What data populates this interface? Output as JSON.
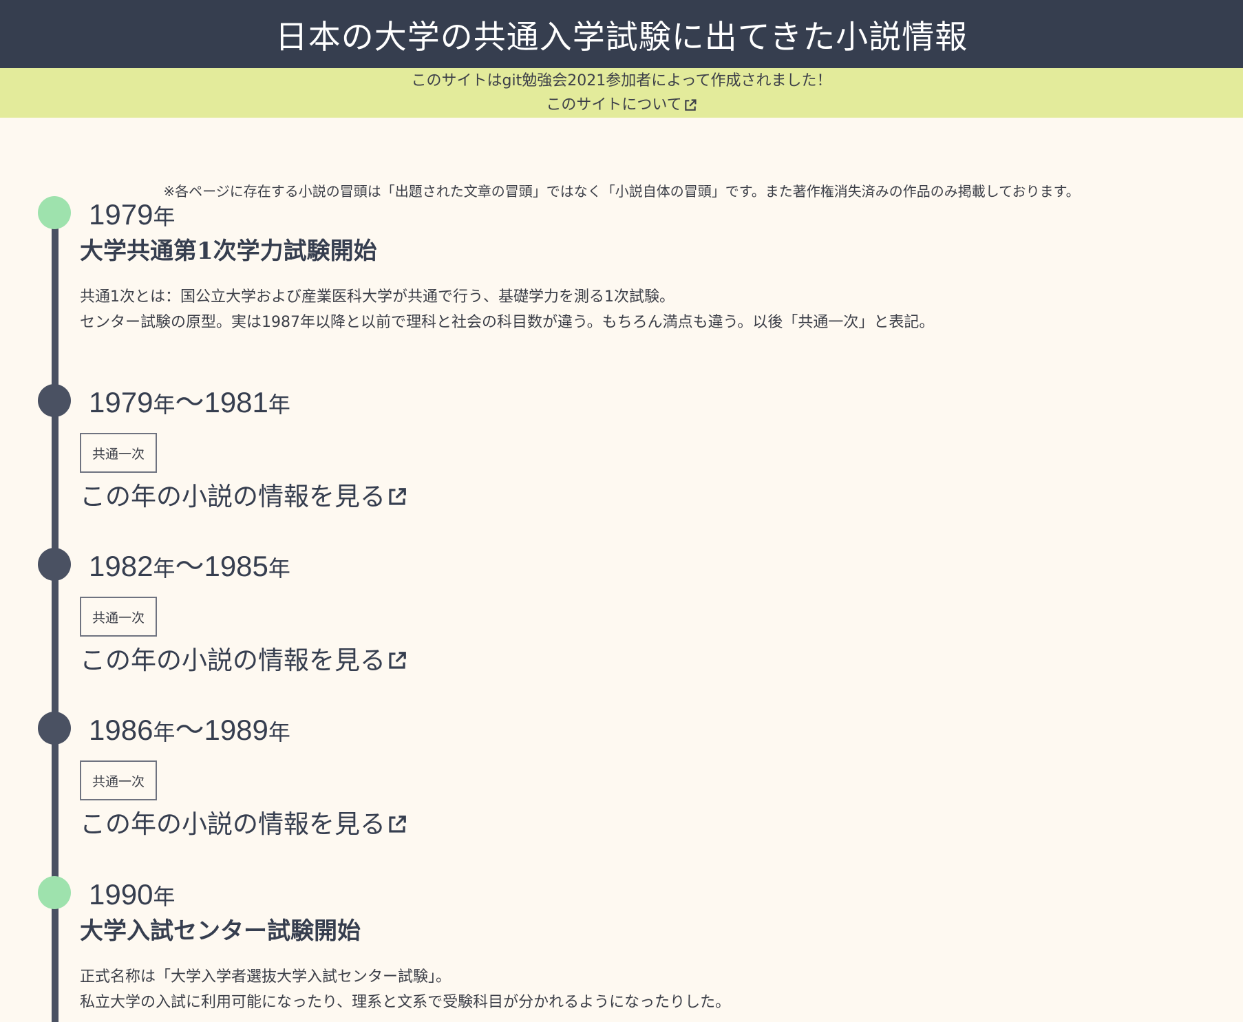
{
  "header": {
    "title": "日本の大学の共通入学試験に出てきた小説情報"
  },
  "banner": {
    "line1": "このサイトはgit勉強会2021参加者によって作成されました！",
    "about_link": "このサイトについて"
  },
  "notice": "※各ページに存在する小説の冒頭は「出題された文章の冒頭」ではなく「小説自体の冒頭」です。また著作権消失済みの作品のみ掲載しております。",
  "timeline": [
    {
      "type": "event",
      "year": "1979",
      "year_suffix": "年",
      "title": "大学共通第1次学力試験開始",
      "desc_line1": "共通1次とは：国公立大学および産業医科大学が共通で行う、基礎学力を測る1次試験。",
      "desc_line2": "センター試験の原型。実は1987年以降と以前で理科と社会の科目数が違う。もちろん満点も違う。以後「共通一次」と表記。"
    },
    {
      "type": "period",
      "start": "1979",
      "end": "1981",
      "year_suffix": "年",
      "separator": "～",
      "tag": "共通一次",
      "link": "この年の小説の情報を見る"
    },
    {
      "type": "period",
      "start": "1982",
      "end": "1985",
      "year_suffix": "年",
      "separator": "～",
      "tag": "共通一次",
      "link": "この年の小説の情報を見る"
    },
    {
      "type": "period",
      "start": "1986",
      "end": "1989",
      "year_suffix": "年",
      "separator": "～",
      "tag": "共通一次",
      "link": "この年の小説の情報を見る"
    },
    {
      "type": "event",
      "year": "1990",
      "year_suffix": "年",
      "title": "大学入試センター試験開始",
      "desc_line1": "正式名称は「大学入学者選抜大学入試センター試験」。",
      "desc_line2": "私立大学の入試に利用可能になったり、理系と文系で受験科目が分かれるようになったりした。"
    }
  ],
  "colors": {
    "header_bg": "#363e4f",
    "banner_bg": "#e3eb9b",
    "page_bg": "#fef9f1",
    "event_marker": "#9ee2ad",
    "period_marker": "#4a5162",
    "timeline_line": "#4a5162"
  },
  "icons": {
    "external_link": "external-link-icon"
  }
}
